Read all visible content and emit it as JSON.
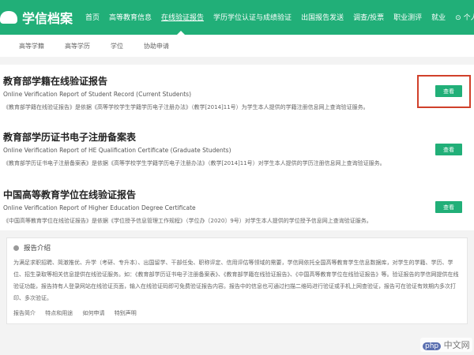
{
  "header": {
    "logo": "学信档案",
    "nav": [
      "首页",
      "高等教育信息",
      "在线验证报告",
      "学历学位认证与成绩验证",
      "出国报告发送",
      "调查/投票",
      "职业测评",
      "就业",
      "个人中心"
    ],
    "active": 2
  },
  "subnav": [
    "高等学籍",
    "高等学历",
    "学位",
    "协助申请"
  ],
  "reports": [
    {
      "title": "教育部学籍在线验证报告",
      "en": "Online Verification Report of Student Record (Current Students)",
      "desc": "《教育部学籍在线验证报告》是依据《高等学校学生学籍学历电子注册办法》（教学[2014]11号）为学生本人提供的学籍注册信息网上查询验证服务。",
      "button": "查看"
    },
    {
      "title": "教育部学历证书电子注册备案表",
      "en": "Online Verification Report of HE Qualification Certificate (Graduate Students)",
      "desc": "《教育部学历证书电子注册备案表》是依据《高等学校学生学籍学历电子注册办法》（教学[2014]11号）对学生本人提供的学历注册信息网上查询验证服务。",
      "button": "查看"
    },
    {
      "title": "中国高等教育学位在线验证报告",
      "en": "Online Verification Report of Higher Education Degree Certificate",
      "desc": "《中国高等教育学位在线验证报告》是依据《学位授予信息管理工作规程》（学位办〔2020〕9号）对学生本人提供的学位授予信息网上查询验证服务。",
      "button": "查看"
    }
  ],
  "intro": {
    "title": "报告介绍",
    "body": "为满足求职招聘、简澈推优、升学（考研、专升本）、出国留学、干部任免、职称评定、信用评估等领域的需要，学信网依托全国高等教育学生信息数据库，对学生的学籍、学历、学位、招生录取等相关信息提供在线验证服务。如：《教育部学历证书电子注册备案表》、《教育部学籍在线验证报告》、《中国高等教育学位在线验证报告》等。验证报告的学信网提供在线验证功能，报告持有人登录网站在线验证页面，输入在线验证码即可免费验证报告内容。报告中的信息也可通过扫描二维码进行验证或手机上网查验证，报告可在验证有效期内多次打印、多次验证。",
    "links": [
      "报告简介",
      "特点和用途",
      "如何申请",
      "特别声明"
    ]
  },
  "watermark": "php 中文网"
}
